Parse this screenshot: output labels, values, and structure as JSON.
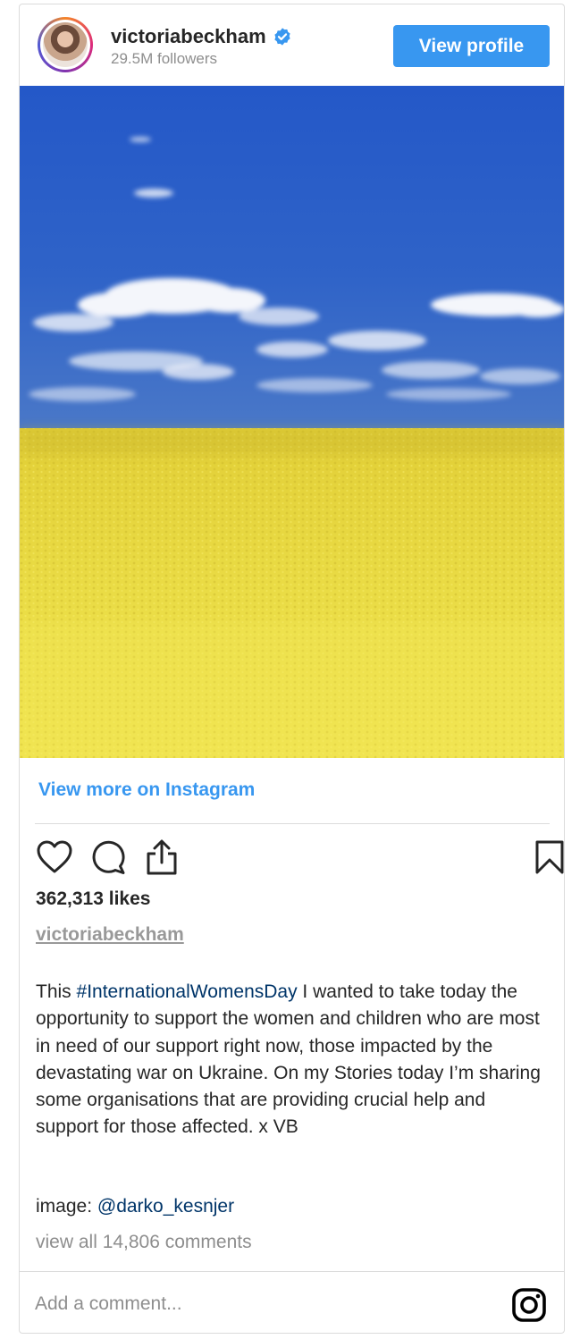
{
  "post": {
    "username": "victoriabeckham",
    "followers": "29.5M followers",
    "view_profile_label": "View profile",
    "view_more_label": "View more on Instagram",
    "likes": "362,313 likes",
    "owner_link": "victoriabeckham",
    "caption": {
      "before_hashtag": "This ",
      "hashtag": "#InternationalWomensDay",
      "after_hashtag": " I wanted to take today the opportunity to support the women and children who are most in need of our support right now, those impacted by the devastating war on Ukraine. On my Stories today I’m sharing some organisations that are providing crucial help and support for those affected. x VB"
    },
    "image_credit_prefix": "image: ",
    "image_credit_mention": "@darko_kesnjer",
    "view_comments": "view all 14,806 comments",
    "comment_placeholder": "Add a comment..."
  },
  "icons": {
    "verified": "verified-badge-icon",
    "like": "heart-icon",
    "comment": "comment-bubble-icon",
    "share": "share-icon",
    "save": "bookmark-icon",
    "instagram": "instagram-logo-icon"
  },
  "colors": {
    "accent": "#3897f0",
    "link": "#003569",
    "muted": "#8e8e8e",
    "sky": "#2f5fc4",
    "field": "#e8d840"
  }
}
